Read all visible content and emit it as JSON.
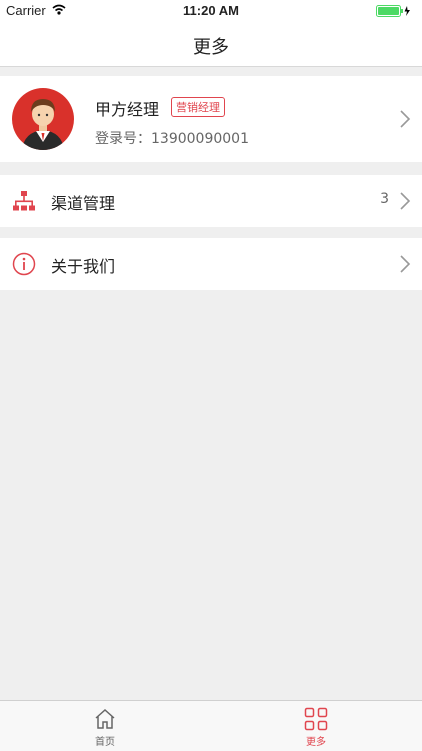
{
  "status_bar": {
    "carrier": "Carrier",
    "time": "11:20 AM"
  },
  "nav": {
    "title": "更多"
  },
  "profile": {
    "name": "甲方经理",
    "role_badge": "营销经理",
    "login_label": "登录号：",
    "login_number": "13900090001"
  },
  "menu": [
    {
      "label": "渠道管理",
      "count": "3",
      "icon": "org-chart-icon"
    },
    {
      "label": "关于我们",
      "icon": "info-icon"
    }
  ],
  "tab_bar": {
    "tabs": [
      {
        "label": "首页",
        "icon": "home-icon",
        "active": false
      },
      {
        "label": "更多",
        "icon": "grid-icon",
        "active": true
      }
    ]
  },
  "colors": {
    "accent": "#e0454e",
    "background": "#efefef",
    "battery": "#4cd964",
    "inactive_tab": "#666666"
  }
}
